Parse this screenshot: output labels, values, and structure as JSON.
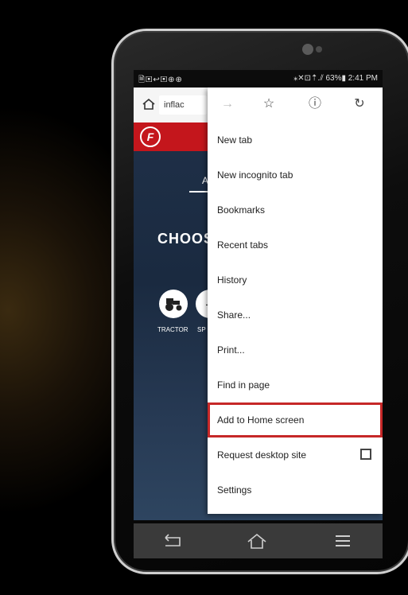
{
  "statusbar": {
    "left_icons": "🗎▣↩▣⊕⊕",
    "right_text": "⁎✕⊡⇡.⫽ 63%▮ 2:41 PM"
  },
  "browser": {
    "url": "inflac",
    "icons": [
      "home-icon",
      "forward-icon",
      "star-icon",
      "info-icon",
      "refresh-icon"
    ]
  },
  "page": {
    "tab_label": "Ag",
    "heading": "CHOOS",
    "tractor_label": "TRACTOR",
    "sport_label": "SP"
  },
  "menu": {
    "items": [
      {
        "label": "New tab"
      },
      {
        "label": "New incognito tab"
      },
      {
        "label": "Bookmarks"
      },
      {
        "label": "Recent tabs"
      },
      {
        "label": "History"
      },
      {
        "label": "Share..."
      },
      {
        "label": "Print..."
      },
      {
        "label": "Find in page"
      },
      {
        "label": "Add to Home screen"
      },
      {
        "label": "Request desktop site"
      },
      {
        "label": "Settings"
      }
    ],
    "highlighted": "Add to Home screen"
  },
  "colors": {
    "brand": "#c4161c",
    "highlight": "#c62828"
  }
}
